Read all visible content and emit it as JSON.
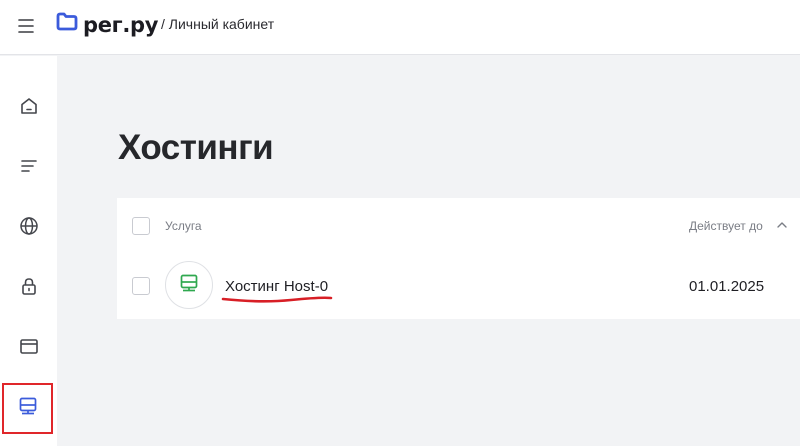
{
  "header": {
    "logo_text": "рег.ру",
    "breadcrumb": "/ Личный кабинет",
    "brand_color": "#3b5bdb"
  },
  "sidebar": {
    "items": [
      {
        "icon": "home-icon",
        "active": false
      },
      {
        "icon": "list-icon",
        "active": false
      },
      {
        "icon": "globe-icon",
        "active": false
      },
      {
        "icon": "lock-icon",
        "active": false
      },
      {
        "icon": "browser-window-icon",
        "active": false
      },
      {
        "icon": "server-icon",
        "active": true
      }
    ],
    "active_highlight_color": "#e0262a"
  },
  "main": {
    "title": "Хостинги",
    "table": {
      "columns": [
        "Услуга",
        "Действует до"
      ],
      "rows": [
        {
          "service": "Хостинг Host-0",
          "valid_until": "01.01.2025",
          "icon": "server-icon",
          "icon_color": "#2fa84f"
        }
      ]
    }
  }
}
